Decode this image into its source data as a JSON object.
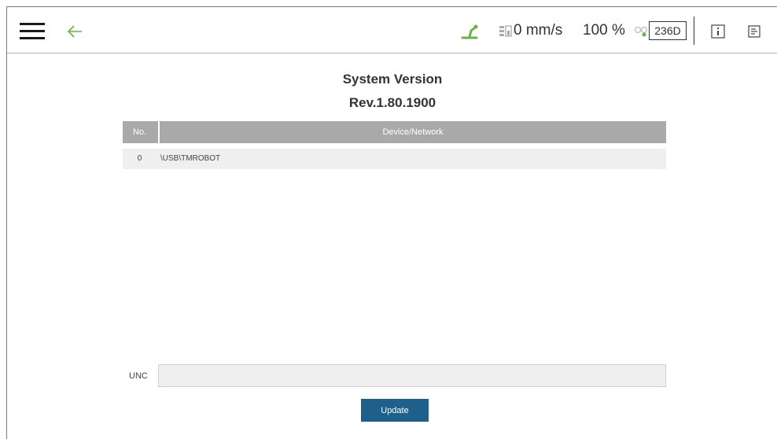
{
  "header": {
    "speed": "0 mm/s",
    "percent": "100 %",
    "counter": "236D"
  },
  "titles": {
    "system_version": "System Version",
    "revision": "Rev.1.80.1900"
  },
  "table": {
    "columns": [
      "No.",
      "Device/Network"
    ],
    "rows": [
      {
        "no": "0",
        "device": "\\USB\\TMROBOT"
      }
    ]
  },
  "unc": {
    "label": "UNC",
    "value": ""
  },
  "update_label": "Update",
  "colors": {
    "accent": "#1f5f8b",
    "robot_status": "#6cb33f",
    "table_header": "#a9a9a9",
    "row_bg": "#efefef"
  },
  "icons": [
    "menu-icon",
    "back-arrow-icon",
    "robot-status-icon",
    "speed-icon",
    "gear-icon",
    "info-icon",
    "log-icon"
  ]
}
